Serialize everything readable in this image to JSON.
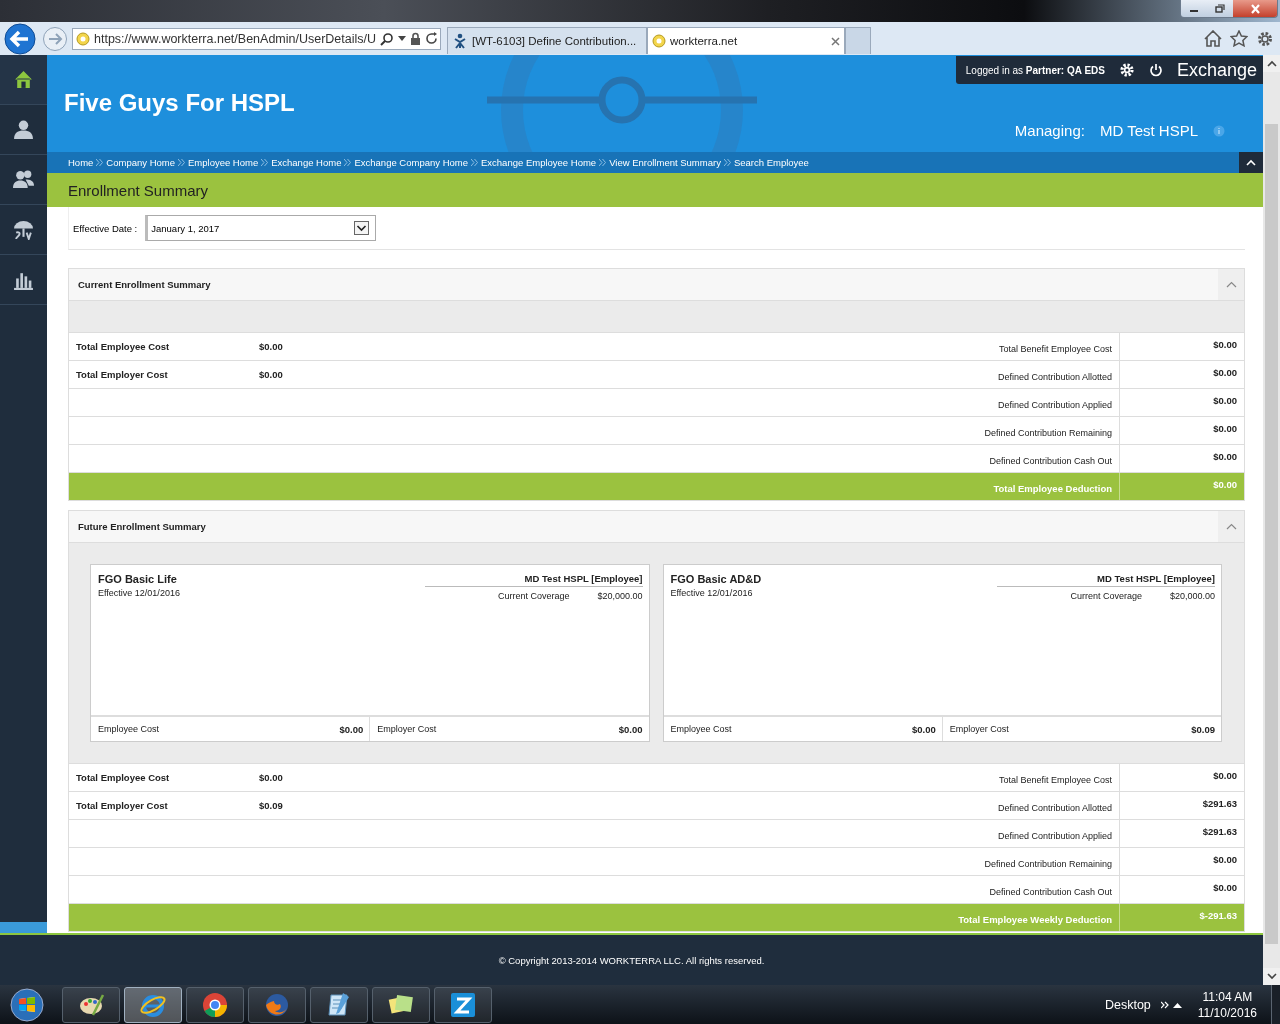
{
  "browser": {
    "address": "https://www.workterra.net/BenAdmin/UserDetails/U",
    "tabs": [
      {
        "title": "[WT-6103] Define Contribution...",
        "selected": false
      },
      {
        "title": "workterra.net",
        "selected": true
      }
    ]
  },
  "sidebar": {
    "items": [
      {
        "kind": "home",
        "selected": true
      },
      {
        "kind": "person",
        "selected": false
      },
      {
        "kind": "people",
        "selected": false
      },
      {
        "kind": "umbrella",
        "selected": false
      },
      {
        "kind": "chart",
        "selected": false
      }
    ]
  },
  "header": {
    "title": "Five Guys For HSPL",
    "login": "Logged in as **Partner:** **QA EDS**",
    "exchange": "Exchange",
    "managing_label": "Managing:",
    "managing_value": "MD Test HSPL"
  },
  "breadcrumbs": [
    "Home",
    "Company Home",
    "Employee Home",
    "Exchange Home",
    "Exchange Company Home",
    "Exchange Employee Home",
    "View Enrollment Summary",
    "Search Employee"
  ],
  "page_title": "Enrollment Summary",
  "effective_date": {
    "label": "Effective Date :",
    "value": "January 1, 2017"
  },
  "current_summary": {
    "title": "Current Enrollment Summary",
    "expanded": true,
    "left_rows": [
      {
        "label": "Total Employee Cost",
        "value": "$0.00"
      },
      {
        "label": "Total Employer Cost",
        "value": "$0.00"
      }
    ],
    "right_rows": [
      {
        "label": "Total Benefit Employee Cost",
        "value": "$0.00"
      },
      {
        "label": "Defined Contribution Allotted",
        "value": "$0.00"
      },
      {
        "label": "Defined Contribution Applied",
        "value": "$0.00"
      },
      {
        "label": "Defined Contribution Remaining",
        "value": "$0.00"
      },
      {
        "label": "Defined Contribution Cash Out",
        "value": "$0.00"
      }
    ],
    "total": {
      "label": "Total Employee Deduction",
      "value": "$0.00"
    }
  },
  "future_summary": {
    "title": "Future Enrollment Summary",
    "expanded": true,
    "plans": [
      {
        "name": "FGO Basic Life",
        "effective": "Effective 12/01/2016",
        "member": "MD Test HSPL [Employee]",
        "coverage_label": "Current Coverage",
        "coverage_value": "$20,000.00",
        "employee_cost_label": "Employee Cost",
        "employee_cost": "$0.00",
        "employer_cost_label": "Employer Cost",
        "employer_cost": "$0.00"
      },
      {
        "name": "FGO Basic AD&D",
        "effective": "Effective 12/01/2016",
        "member": "MD Test HSPL [Employee]",
        "coverage_label": "Current Coverage",
        "coverage_value": "$20,000.00",
        "employee_cost_label": "Employee Cost",
        "employee_cost": "$0.00",
        "employer_cost_label": "Employer Cost",
        "employer_cost": "$0.09"
      }
    ],
    "left_rows": [
      {
        "label": "Total Employee Cost",
        "value": "$0.00"
      },
      {
        "label": "Total Employer Cost",
        "value": "$0.09"
      }
    ],
    "right_rows": [
      {
        "label": "Total Benefit Employee Cost",
        "value": "$0.00"
      },
      {
        "label": "Defined Contribution Allotted",
        "value": "$291.63"
      },
      {
        "label": "Defined Contribution Applied",
        "value": "$291.63"
      },
      {
        "label": "Defined Contribution Remaining",
        "value": "$0.00"
      },
      {
        "label": "Defined Contribution Cash Out",
        "value": "$0.00"
      }
    ],
    "total": {
      "label": "Total Employee Weekly Deduction",
      "value": "$-291.63"
    }
  },
  "footer": "© Copyright 2013-2014 WORKTERRA LLC. All rights reserved.",
  "taskbar": {
    "apps": [
      {
        "kind": "paint",
        "selected": false
      },
      {
        "kind": "ie",
        "selected": true
      },
      {
        "kind": "chrome",
        "selected": false
      },
      {
        "kind": "firefox",
        "selected": false
      },
      {
        "kind": "notepad",
        "selected": false
      },
      {
        "kind": "notes",
        "selected": false
      },
      {
        "kind": "z",
        "selected": false
      }
    ],
    "desktop": "Desktop",
    "time": "11:04 AM",
    "date": "11/10/2016"
  }
}
